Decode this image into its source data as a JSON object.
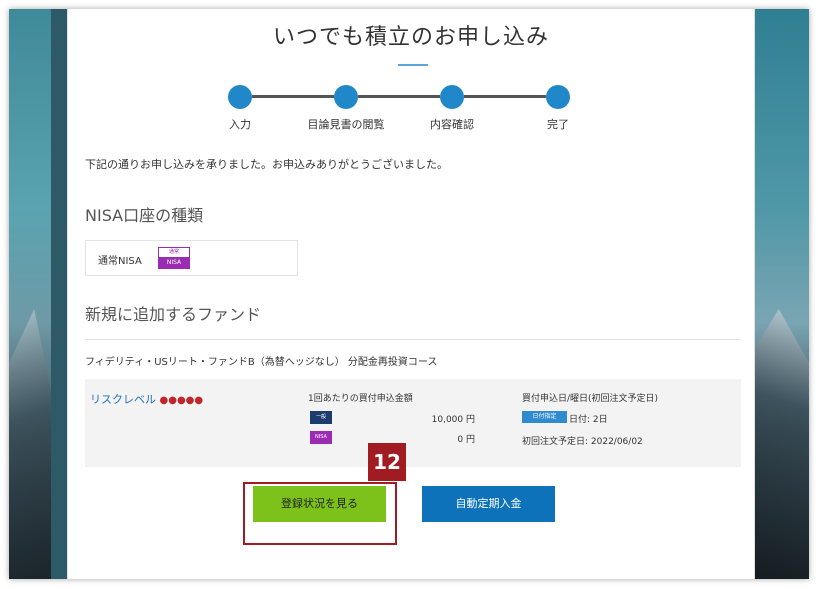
{
  "page": {
    "title": "いつでも積立のお申し込み",
    "steps": [
      "入力",
      "目論見書の閲覧",
      "内容確認",
      "完了"
    ],
    "notice": "下記の通りお申し込みを承りました。お申込みありがとうございました。"
  },
  "nisa_section": {
    "heading": "NISA口座の種類",
    "account_type": "通常NISA",
    "badge_top": "通常",
    "badge_bottom": "NISA"
  },
  "fund_section": {
    "heading": "新規に追加するファンド",
    "fund_name": "フィデリティ・USリート・ファンドB（為替ヘッジなし） 分配金再投資コース",
    "risk_label": "リスクレベル",
    "risk_dots": "●●●●●",
    "amount_header": "1回あたりの買付申込金額",
    "tag_ippan": "一般",
    "tag_nisa": "NISA",
    "amount_ippan": "10,000 円",
    "amount_nisa": "0 円",
    "date_header": "買付申込日/曜日(初回注文予定日)",
    "date_tag": "日付指定",
    "date_value": "日付: 2日",
    "first_order": "初回注文予定日: 2022/06/02"
  },
  "buttons": {
    "view_status": "登録状況を見る",
    "auto_deposit": "自動定期入金"
  },
  "annotation": {
    "badge_number": "12"
  },
  "colors": {
    "accent_blue": "#2088c8",
    "green_button": "#7cc21a",
    "blue_button": "#0d72b9",
    "nisa_purple": "#9a2bb3",
    "highlight_red": "#a01c22"
  }
}
